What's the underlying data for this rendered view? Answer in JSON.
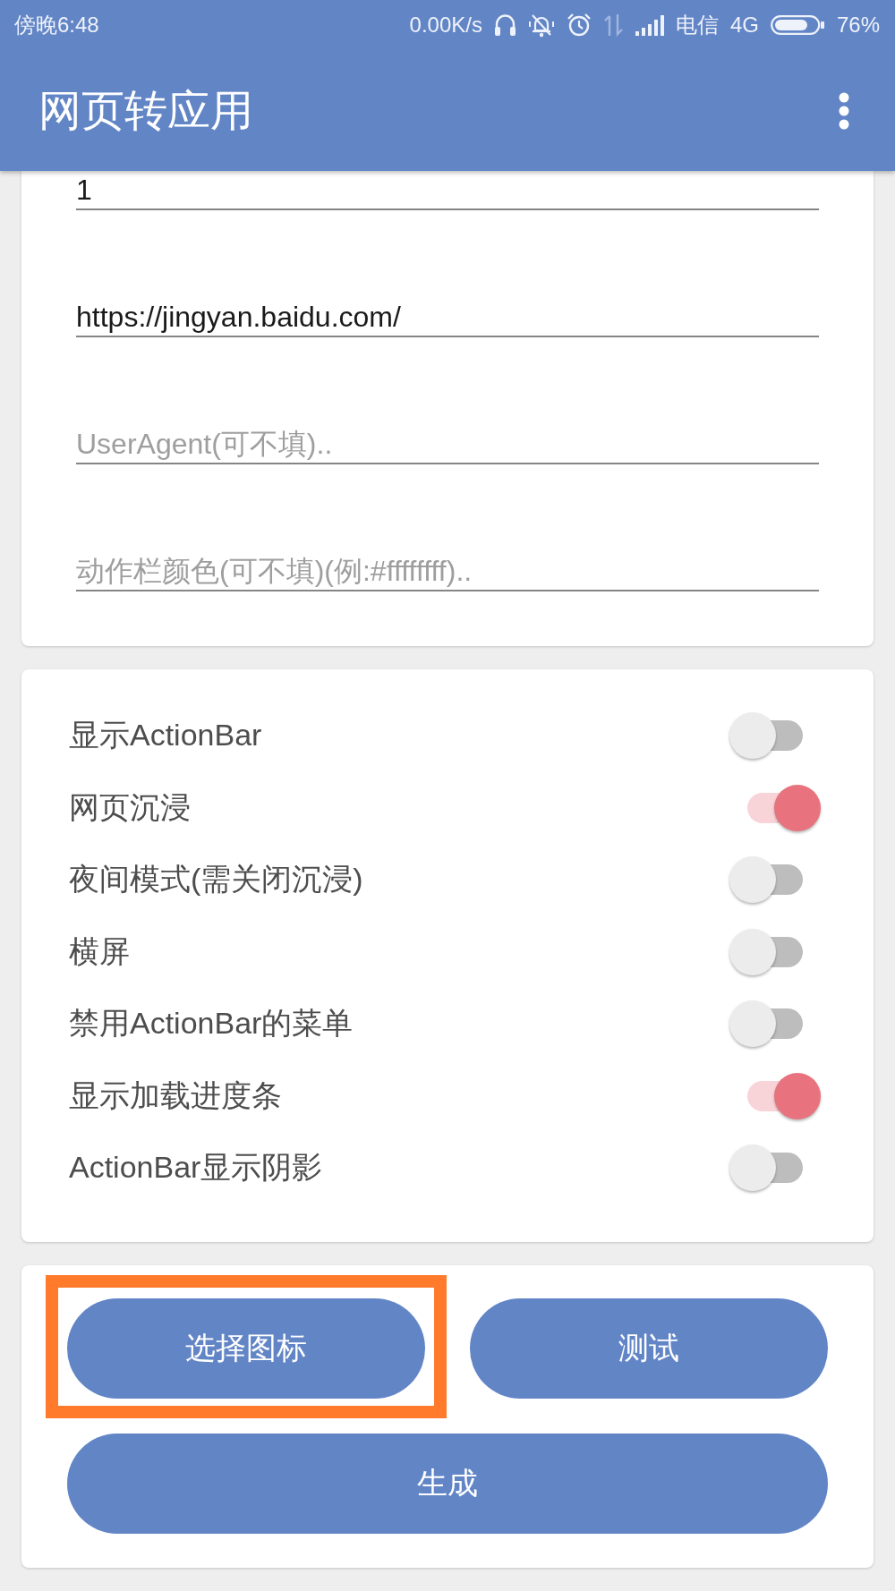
{
  "status_bar": {
    "time": "傍晚6:48",
    "net_speed": "0.00K/s",
    "carrier": "电信",
    "network": "4G",
    "battery_text": "76%"
  },
  "app_bar": {
    "title": "网页转应用"
  },
  "fields": [
    {
      "value": "1"
    },
    {
      "value": "https://jingyan.baidu.com/"
    },
    {
      "placeholder": "UserAgent(可不填).."
    },
    {
      "placeholder": "动作栏颜色(可不填)(例:#ffffffff).."
    }
  ],
  "switches": [
    {
      "label": "显示ActionBar",
      "on": false
    },
    {
      "label": "网页沉浸",
      "on": true
    },
    {
      "label": "夜间模式(需关闭沉浸)",
      "on": false
    },
    {
      "label": "横屏",
      "on": false
    },
    {
      "label": "禁用ActionBar的菜单",
      "on": false
    },
    {
      "label": "显示加载进度条",
      "on": true
    },
    {
      "label": "ActionBar显示阴影",
      "on": false
    }
  ],
  "buttons": [
    {
      "label": "选择图标",
      "highlighted": true
    },
    {
      "label": "测试",
      "highlighted": false
    },
    {
      "label": "生成",
      "highlighted": false
    }
  ]
}
